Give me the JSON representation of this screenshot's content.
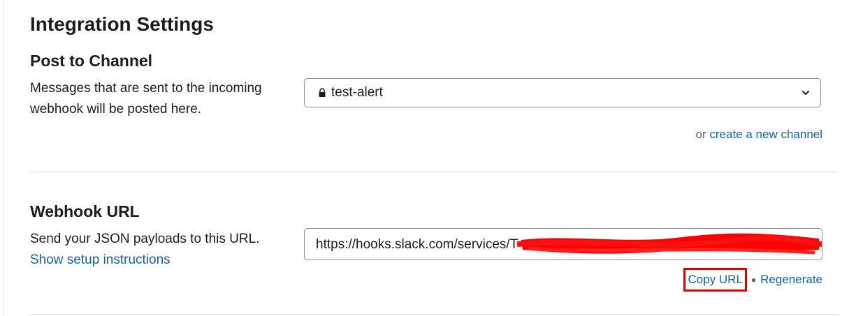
{
  "page": {
    "title": "Integration Settings"
  },
  "post_to_channel": {
    "title": "Post to Channel",
    "description": "Messages that are sent to the incoming webhook will be posted here.",
    "selected_channel": "test-alert",
    "channel_icon": "lock-icon",
    "dropdown_icon": "chevron-down-icon",
    "or_text": "or",
    "create_link": "create a new channel"
  },
  "webhook": {
    "title": "Webhook URL",
    "description": "Send your JSON payloads to this URL.",
    "setup_link": "Show setup instructions",
    "url_visible": "https://hooks.slack.com/services/T",
    "copy_label": "Copy URL",
    "separator": "●",
    "regenerate_label": "Regenerate"
  },
  "colors": {
    "link": "#1264a3",
    "text": "#1d1c1d",
    "muted": "#616061",
    "highlight_box": "#e00000",
    "redaction": "#ff0000"
  }
}
